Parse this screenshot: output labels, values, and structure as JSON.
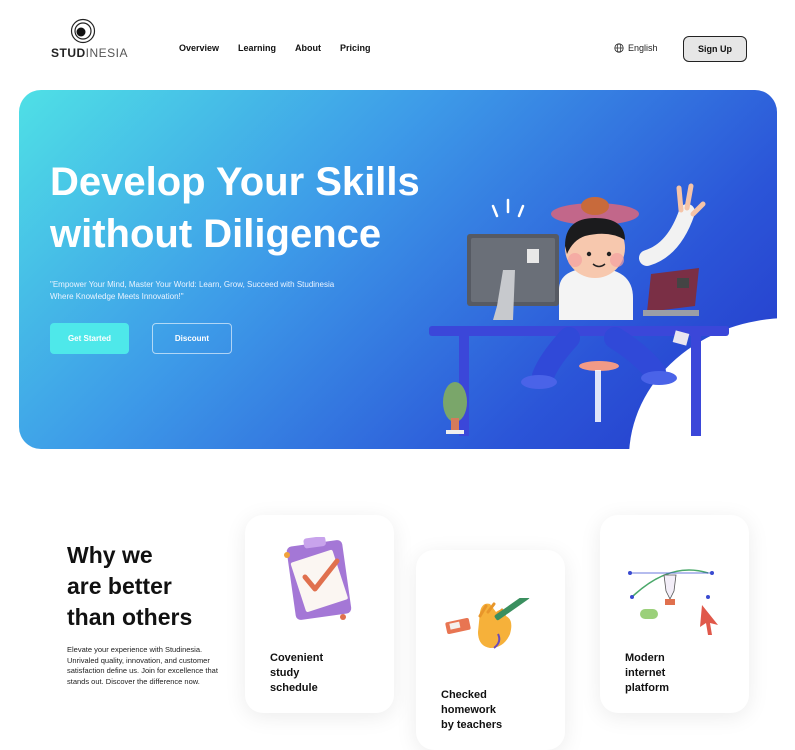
{
  "brand": {
    "name_bold": "STUD",
    "name_light": "INESIA"
  },
  "nav": {
    "items": [
      {
        "label": "Overview"
      },
      {
        "label": "Learning"
      },
      {
        "label": "About"
      },
      {
        "label": "Pricing"
      }
    ]
  },
  "header": {
    "language": "English",
    "signup_label": "Sign Up"
  },
  "hero": {
    "title_line1": "Develop Your Skills",
    "title_line2": "without Diligence",
    "subtitle": "\"Empower Your Mind, Master Your World: Learn, Grow, Succeed with Studinesia Where Knowledge Meets Innovation!\"",
    "primary_button": "Get Started",
    "secondary_button": "Discount"
  },
  "why": {
    "title_line1": "Why we",
    "title_line2": "are better",
    "title_line3": "than others",
    "description": "Elevate your experience with Studinesia. Unrivaled quality, innovation, and customer satisfaction define us. Join for excellence that stands out. Discover the difference now."
  },
  "features": [
    {
      "line1": "Covenient",
      "line2": "study",
      "line3": "schedule",
      "icon": "clipboard-check-icon"
    },
    {
      "line1": "Checked",
      "line2": "homework",
      "line3": "by teachers",
      "icon": "hand-pencil-icon"
    },
    {
      "line1": "Modern",
      "line2": "internet",
      "line3": "platform",
      "icon": "vector-pen-icon"
    }
  ],
  "colors": {
    "hero_gradient_start": "#4fe0e6",
    "hero_gradient_end": "#2437c9",
    "accent_cyan": "#4ee8ea"
  }
}
